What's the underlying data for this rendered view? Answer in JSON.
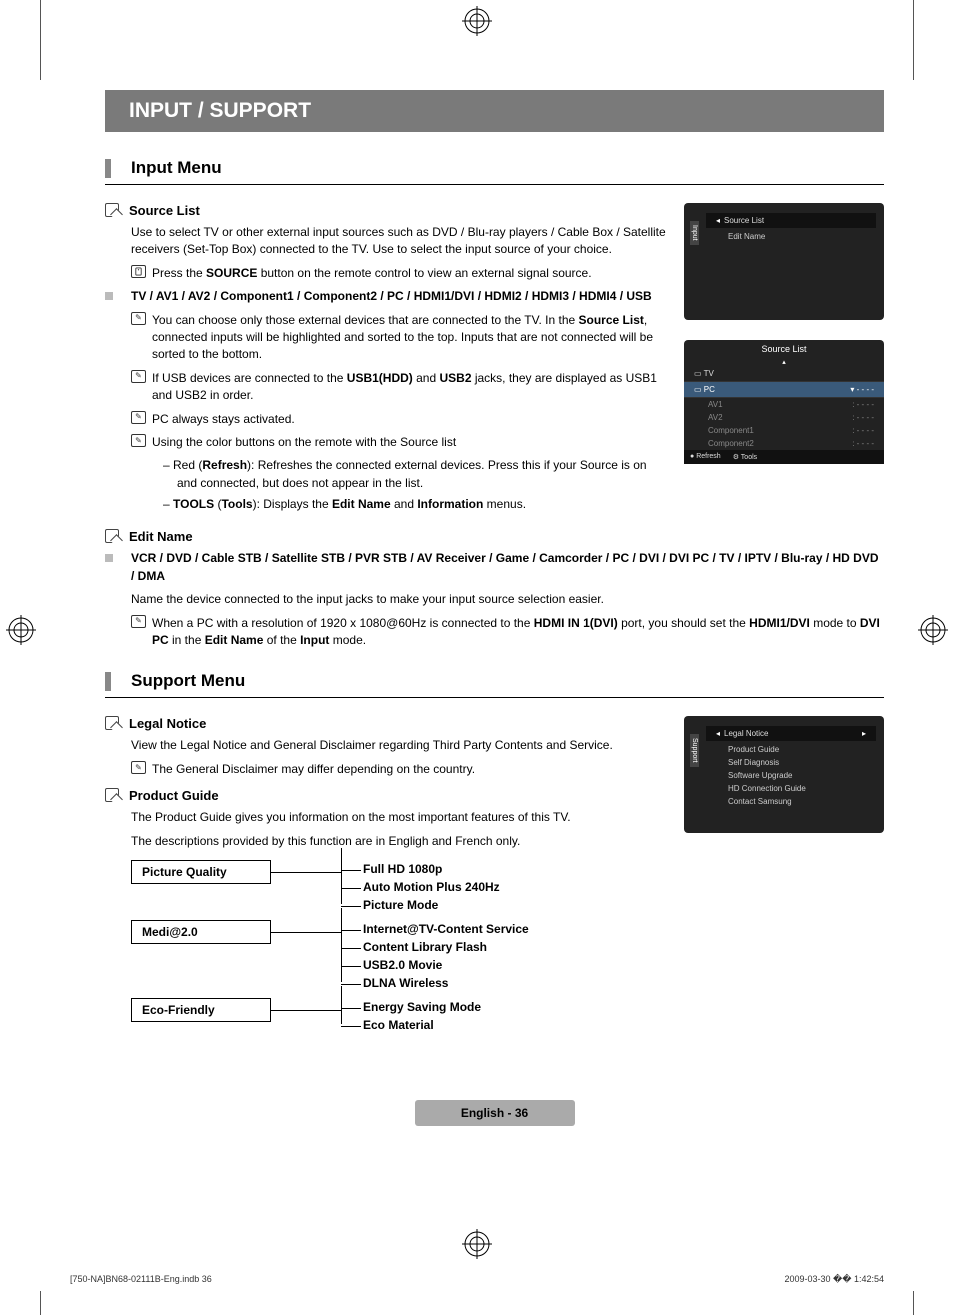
{
  "chapter_title": "INPUT / SUPPORT",
  "section1_title": "Input Menu",
  "source_list_heading": "Source List",
  "source_list_body": "Use to select TV or other external input sources such as DVD / Blu-ray players / Cable Box / Satellite receivers (Set-Top Box) connected to the TV. Use to select the input source of your choice.",
  "source_list_remote_pre": "Press the ",
  "source_list_remote_bold": "SOURCE",
  "source_list_remote_post": " button on the remote control to view an external signal source.",
  "inputs_list": "TV / AV1 / AV2 / Component1 / Component2 / PC / HDMI1/DVI / HDMI2 / HDMI3 / HDMI4 / USB",
  "note1_a": "You can choose only those external devices that are connected to the TV. In the ",
  "note1_b": "Source List",
  "note1_c": ", connected inputs will be highlighted and sorted to the top. Inputs that are not connected will be sorted to the bottom.",
  "note2_a": "If USB devices are connected to the ",
  "note2_b": "USB1(HDD)",
  "note2_c": " and ",
  "note2_d": "USB2",
  "note2_e": " jacks, they are displayed as USB1 and USB2 in order.",
  "note3": "PC always stays activated.",
  "note4": "Using the color buttons on the remote with the Source list",
  "dash1_a": "Red (",
  "dash1_b": "Refresh",
  "dash1_c": "): Refreshes the connected external devices. Press this if your Source is on and connected, but does not appear in the list.",
  "dash2_a": "TOOLS",
  "dash2_b": " (",
  "dash2_c": "Tools",
  "dash2_d": "): Displays the ",
  "dash2_e": "Edit Name",
  "dash2_f": " and ",
  "dash2_g": "Information",
  "dash2_h": " menus.",
  "edit_name_heading": "Edit Name",
  "edit_name_list": "VCR / DVD / Cable STB / Satellite STB / PVR STB / AV Receiver / Game / Camcorder / PC / DVI / DVI PC / TV / IPTV / Blu-ray / HD DVD / DMA",
  "edit_name_body": "Name the device connected to the input jacks to make your input source selection easier.",
  "edit_name_note_a": "When a PC with a resolution of 1920 x 1080@60Hz is connected to the ",
  "edit_name_note_b": "HDMI IN 1(DVI)",
  "edit_name_note_c": " port, you should set the ",
  "edit_name_note_d": "HDMI1/DVI",
  "edit_name_note_e": " mode to ",
  "edit_name_note_f": "DVI PC",
  "edit_name_note_g": " in the ",
  "edit_name_note_h": "Edit Name",
  "edit_name_note_i": " of the ",
  "edit_name_note_j": "Input",
  "edit_name_note_k": " mode.",
  "section2_title": "Support Menu",
  "legal_heading": "Legal Notice",
  "legal_body": "View the Legal Notice and General Disclaimer regarding Third Party Contents and Service.",
  "legal_note": "The General Disclaimer may differ depending on the country.",
  "pg_heading": "Product Guide",
  "pg_body1": "The Product Guide gives you information on the most important features of this TV.",
  "pg_body2": "The descriptions provided by this function are in Engligh and French only.",
  "tree_box1": "Picture Quality",
  "tree1_items": [
    "Full HD 1080p",
    "Auto Motion Plus 240Hz",
    "Picture Mode"
  ],
  "tree_box2": "Medi@2.0",
  "tree2_items": [
    "Internet@TV-Content Service",
    "Content Library Flash",
    "USB2.0 Movie",
    "DLNA Wireless"
  ],
  "tree_box3": "Eco-Friendly",
  "tree3_items": [
    "Energy Saving Mode",
    "Eco Material"
  ],
  "osd1": {
    "tab": "Input",
    "title": "Source List",
    "item": "Edit Name"
  },
  "osd2": {
    "title": "Source List",
    "tv": "TV",
    "pc": "PC",
    "pc_val": "- - - -",
    "rows": [
      {
        "l": "AV1",
        "r": "- - - -"
      },
      {
        "l": "AV2",
        "r": "- - - -"
      },
      {
        "l": "Component1",
        "r": "- - - -"
      },
      {
        "l": "Component2",
        "r": "- - - -"
      }
    ],
    "refresh": "Refresh",
    "tools": "Tools"
  },
  "osd3": {
    "tab": "Support",
    "title": "Legal Notice",
    "items": [
      "Product Guide",
      "Self Diagnosis",
      "Software Upgrade",
      "HD Connection Guide",
      "Contact Samsung"
    ]
  },
  "page_lang": "English - 36",
  "footer_left": "[750-NA]BN68-02111B-Eng.indb   36",
  "footer_right": "2009-03-30   �� 1:42:54",
  "dash_prefix": "–   "
}
